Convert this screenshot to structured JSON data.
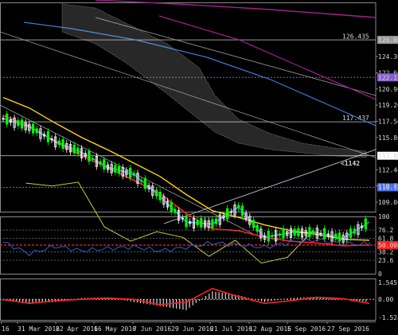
{
  "chart_data": [
    {
      "type": "line",
      "panel": "price",
      "title": "",
      "ylim": [
        108.0,
        130.0
      ],
      "x": [
        "2016-03-17",
        "2016-03-31",
        "2016-04-14",
        "2016-04-28",
        "2016-05-12",
        "2016-05-26",
        "2016-06-09",
        "2016-06-23",
        "2016-07-07",
        "2016-07-21",
        "2016-08-04",
        "2016-08-18",
        "2016-09-01",
        "2016-09-15",
        "2016-09-29"
      ],
      "x_tick_labels": [
        "16",
        "31 Mar 2016",
        "22 Apr 2016",
        "16 May 2016",
        "7 Jun 2016",
        "29 Jun 2016",
        "21 Jul 2016",
        "12 Aug 2016",
        "5 Sep 2016",
        "27 Sep 2016"
      ],
      "y_tick_labels": [
        "126.435",
        "126.060",
        "124.30",
        "122.60",
        "122.115",
        "120.90",
        "119.20",
        "117.437",
        "117.50",
        "115.80",
        "113.882",
        "112.40",
        "110.556",
        "110.70",
        "109.00"
      ],
      "series": [
        {
          "values": [
            113.8,
            112.9,
            111.4,
            110.2,
            108.7,
            107.9,
            105.6,
            102.9,
            102.7,
            104.5,
            101.3,
            101.8,
            101.8,
            101.2,
            102.9
          ]
        },
        {
          "values": [
            115.1,
            114.0,
            112.3,
            110.9,
            109.6,
            108.3,
            106.9,
            104.8,
            103.2,
            103.0,
            102.3,
            101.9,
            101.7,
            101.4,
            101.5
          ]
        },
        {
          "values": [
            116.8,
            115.7,
            114.1,
            112.6,
            111.3,
            109.9,
            108.5,
            106.6,
            104.9,
            104.2,
            103.4,
            102.8,
            102.4,
            101.9,
            101.8
          ]
        }
      ],
      "annotations": [
        "<1142"
      ],
      "colors": {
        "candle_up": "#ffffff",
        "candle_down": "#00ff00",
        "tenkan": "#1e90ff",
        "kijun": "#ffd700",
        "chikou": "#cccc33",
        "ma_red": "#ff2020",
        "ma_blue": "#3a7bd5",
        "ma_magenta": "#a0208f",
        "cloud": "#dcdcdc"
      }
    },
    {
      "type": "line",
      "panel": "rsi",
      "ylim": [
        0,
        100
      ],
      "y_tick_labels": [
        "100",
        "76.2",
        "61.8",
        "50.000",
        "38.2",
        "23.6",
        "0"
      ],
      "series": [
        {
          "values": [
            55,
            35,
            48,
            40,
            44,
            47,
            40,
            46,
            54,
            50,
            46,
            55,
            59,
            52,
            52
          ]
        }
      ],
      "colors": {
        "rsi": "#2f5fd0",
        "level_50": "#ff2020"
      }
    },
    {
      "type": "bar",
      "panel": "oscillator",
      "ylim": [
        -1.5244,
        1.5451
      ],
      "y_tick_labels": [
        "1.5451",
        "0.00",
        "-1.5244"
      ],
      "series": [
        {
          "values": [
            -0.1,
            -0.3,
            -0.2,
            0.1,
            0.15,
            -0.2,
            -0.5,
            -0.8,
            0.6,
            0.3,
            -0.2,
            0.1,
            0.2,
            0.0,
            -0.2
          ]
        },
        {
          "values": [
            0.0,
            -0.3,
            -0.1,
            0.0,
            0.1,
            0.0,
            -0.4,
            -0.2,
            0.8,
            0.2,
            -0.3,
            -0.1,
            0.15,
            0.05,
            -0.3
          ]
        }
      ],
      "colors": {
        "histogram": "#ffffff",
        "signal": "#ff2020",
        "zero": "#cccccc"
      }
    }
  ]
}
